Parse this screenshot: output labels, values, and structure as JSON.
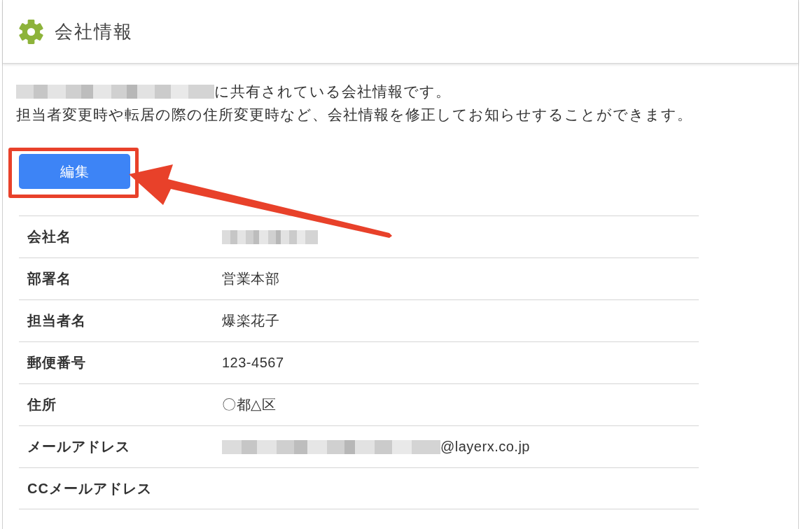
{
  "header": {
    "title": "会社情報"
  },
  "intro": [
    {
      "kind": "masked",
      "text": "に共有されている会社情報です。"
    },
    {
      "kind": "text",
      "text": "担当者変更時や転居の際の住所変更時など、会社情報を修正してお知らせすることができます。"
    }
  ],
  "edit_button": {
    "label": "編集",
    "highlighted": true
  },
  "details": [
    {
      "label": "会社名",
      "kind": "redacted"
    },
    {
      "label": "部署名",
      "kind": "text",
      "value": "営業本部"
    },
    {
      "label": "担当者名",
      "kind": "text",
      "value": "爆楽花子"
    },
    {
      "label": "郵便番号",
      "kind": "text",
      "value": "123-4567"
    },
    {
      "label": "住所",
      "kind": "text",
      "value": "〇都△区"
    },
    {
      "label": "メールアドレス",
      "kind": "masked",
      "value": "@layerx.co.jp"
    },
    {
      "label": "CCメールアドレス",
      "kind": "blank"
    }
  ]
}
